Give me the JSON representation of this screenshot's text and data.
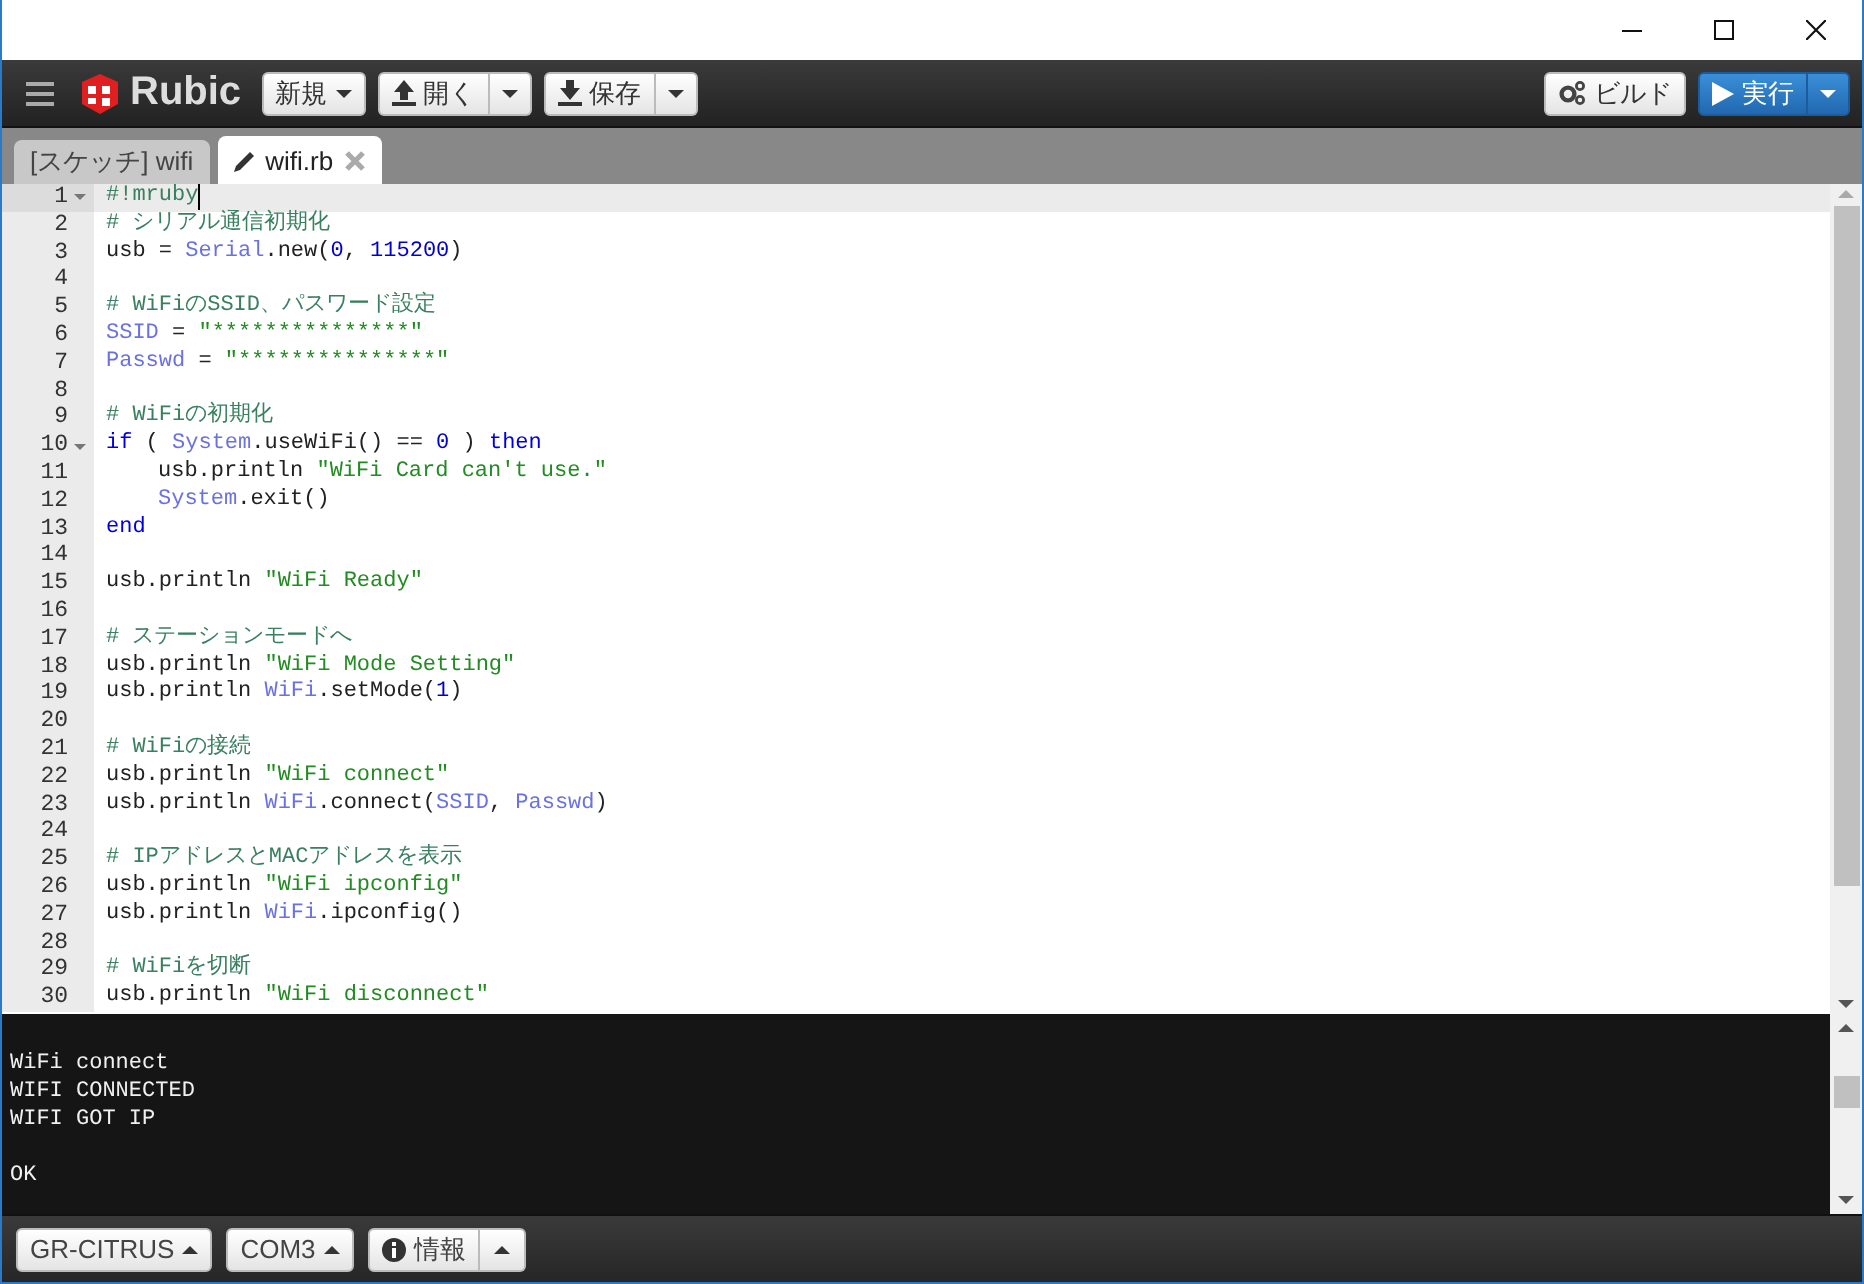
{
  "toolbar": {
    "logo": "Rubic",
    "new_button": "新規",
    "open_button": "開く",
    "save_button": "保存",
    "build_button": "ビルド",
    "run_button": "実行"
  },
  "tabs": [
    {
      "label": "[スケッチ] wifi",
      "selected": false,
      "kind": "sketch"
    },
    {
      "label": "wifi.rb",
      "selected": true,
      "kind": "file"
    }
  ],
  "editor": {
    "lines": [
      {
        "number": "1",
        "fold": true,
        "active": true,
        "tokens": [
          {
            "kind": "comment",
            "text": "#!mruby"
          }
        ]
      },
      {
        "number": "2",
        "fold": false,
        "active": false,
        "tokens": [
          {
            "kind": "comment",
            "text": "# シリアル通信初期化"
          }
        ]
      },
      {
        "number": "3",
        "fold": false,
        "active": false,
        "tokens": [
          {
            "kind": "plain",
            "text": "usb = "
          },
          {
            "kind": "constant",
            "text": "Serial"
          },
          {
            "kind": "plain",
            "text": ".new("
          },
          {
            "kind": "number",
            "text": "0"
          },
          {
            "kind": "plain",
            "text": ", "
          },
          {
            "kind": "number",
            "text": "115200"
          },
          {
            "kind": "plain",
            "text": ")"
          }
        ]
      },
      {
        "number": "4",
        "fold": false,
        "active": false
      },
      {
        "number": "5",
        "fold": false,
        "active": false,
        "tokens": [
          {
            "kind": "comment",
            "text": "# WiFiのSSID、パスワード設定"
          }
        ]
      },
      {
        "number": "6",
        "fold": false,
        "active": false,
        "tokens": [
          {
            "kind": "constant",
            "text": "SSID"
          },
          {
            "kind": "plain",
            "text": " = "
          },
          {
            "kind": "string",
            "text": "\"***************\""
          }
        ]
      },
      {
        "number": "7",
        "fold": false,
        "active": false,
        "tokens": [
          {
            "kind": "constant",
            "text": "Passwd"
          },
          {
            "kind": "plain",
            "text": " = "
          },
          {
            "kind": "string",
            "text": "\"***************\""
          }
        ]
      },
      {
        "number": "8",
        "fold": false,
        "active": false
      },
      {
        "number": "9",
        "fold": false,
        "active": false,
        "tokens": [
          {
            "kind": "comment",
            "text": "# WiFiの初期化"
          }
        ]
      },
      {
        "number": "10",
        "fold": true,
        "active": false,
        "tokens": [
          {
            "kind": "keyword",
            "text": "if"
          },
          {
            "kind": "plain",
            "text": " ( "
          },
          {
            "kind": "constant",
            "text": "System"
          },
          {
            "kind": "plain",
            "text": ".useWiFi() == "
          },
          {
            "kind": "number",
            "text": "0"
          },
          {
            "kind": "plain",
            "text": " ) "
          },
          {
            "kind": "keyword",
            "text": "then"
          }
        ]
      },
      {
        "number": "11",
        "fold": false,
        "active": false,
        "indented": true,
        "tokens": [
          {
            "kind": "plain",
            "text": "usb.println "
          },
          {
            "kind": "string",
            "text": "\"WiFi Card can't use.\""
          }
        ]
      },
      {
        "number": "12",
        "fold": false,
        "active": false,
        "indented": true,
        "tokens": [
          {
            "kind": "constant",
            "text": "System"
          },
          {
            "kind": "plain",
            "text": ".exit()"
          }
        ]
      },
      {
        "number": "13",
        "fold": false,
        "active": false,
        "tokens": [
          {
            "kind": "keyword",
            "text": "end"
          }
        ]
      },
      {
        "number": "14",
        "fold": false,
        "active": false
      },
      {
        "number": "15",
        "fold": false,
        "active": false,
        "tokens": [
          {
            "kind": "plain",
            "text": "usb.println "
          },
          {
            "kind": "string",
            "text": "\"WiFi Ready\""
          }
        ]
      },
      {
        "number": "16",
        "fold": false,
        "active": false
      },
      {
        "number": "17",
        "fold": false,
        "active": false,
        "tokens": [
          {
            "kind": "comment",
            "text": "# ステーションモードへ"
          }
        ]
      },
      {
        "number": "18",
        "fold": false,
        "active": false,
        "tokens": [
          {
            "kind": "plain",
            "text": "usb.println "
          },
          {
            "kind": "string",
            "text": "\"WiFi Mode Setting\""
          }
        ]
      },
      {
        "number": "19",
        "fold": false,
        "active": false,
        "tokens": [
          {
            "kind": "plain",
            "text": "usb.println "
          },
          {
            "kind": "constant",
            "text": "WiFi"
          },
          {
            "kind": "plain",
            "text": ".setMode("
          },
          {
            "kind": "number",
            "text": "1"
          },
          {
            "kind": "plain",
            "text": ")"
          }
        ]
      },
      {
        "number": "20",
        "fold": false,
        "active": false
      },
      {
        "number": "21",
        "fold": false,
        "active": false,
        "tokens": [
          {
            "kind": "comment",
            "text": "# WiFiの接続"
          }
        ]
      },
      {
        "number": "22",
        "fold": false,
        "active": false,
        "tokens": [
          {
            "kind": "plain",
            "text": "usb.println "
          },
          {
            "kind": "string",
            "text": "\"WiFi connect\""
          }
        ]
      },
      {
        "number": "23",
        "fold": false,
        "active": false,
        "tokens": [
          {
            "kind": "plain",
            "text": "usb.println "
          },
          {
            "kind": "constant",
            "text": "WiFi"
          },
          {
            "kind": "plain",
            "text": ".connect("
          },
          {
            "kind": "constant",
            "text": "SSID"
          },
          {
            "kind": "plain",
            "text": ", "
          },
          {
            "kind": "constant",
            "text": "Passwd"
          },
          {
            "kind": "plain",
            "text": ")"
          }
        ]
      },
      {
        "number": "24",
        "fold": false,
        "active": false
      },
      {
        "number": "25",
        "fold": false,
        "active": false,
        "tokens": [
          {
            "kind": "comment",
            "text": "# IPアドレスとMACアドレスを表示"
          }
        ]
      },
      {
        "number": "26",
        "fold": false,
        "active": false,
        "tokens": [
          {
            "kind": "plain",
            "text": "usb.println "
          },
          {
            "kind": "string",
            "text": "\"WiFi ipconfig\""
          }
        ]
      },
      {
        "number": "27",
        "fold": false,
        "active": false,
        "tokens": [
          {
            "kind": "plain",
            "text": "usb.println "
          },
          {
            "kind": "constant",
            "text": "WiFi"
          },
          {
            "kind": "plain",
            "text": ".ipconfig()"
          }
        ]
      },
      {
        "number": "28",
        "fold": false,
        "active": false
      },
      {
        "number": "29",
        "fold": false,
        "active": false,
        "tokens": [
          {
            "kind": "comment",
            "text": "# WiFiを切断"
          }
        ]
      },
      {
        "number": "30",
        "fold": false,
        "active": false,
        "tokens": [
          {
            "kind": "plain",
            "text": "usb.println "
          },
          {
            "kind": "string",
            "text": "\"WiFi disconnect\""
          }
        ]
      }
    ]
  },
  "console": {
    "lines": [
      {
        "text": "WiFi connect",
        "gap_before": false
      },
      {
        "text": "WIFI CONNECTED",
        "gap_before": false
      },
      {
        "text": "WIFI GOT IP",
        "gap_before": false
      },
      {
        "text": "OK",
        "gap_before": true
      }
    ]
  },
  "status_bar": {
    "board_button": "GR-CITRUS",
    "port_button": "COM3",
    "info_button": "情報"
  }
}
